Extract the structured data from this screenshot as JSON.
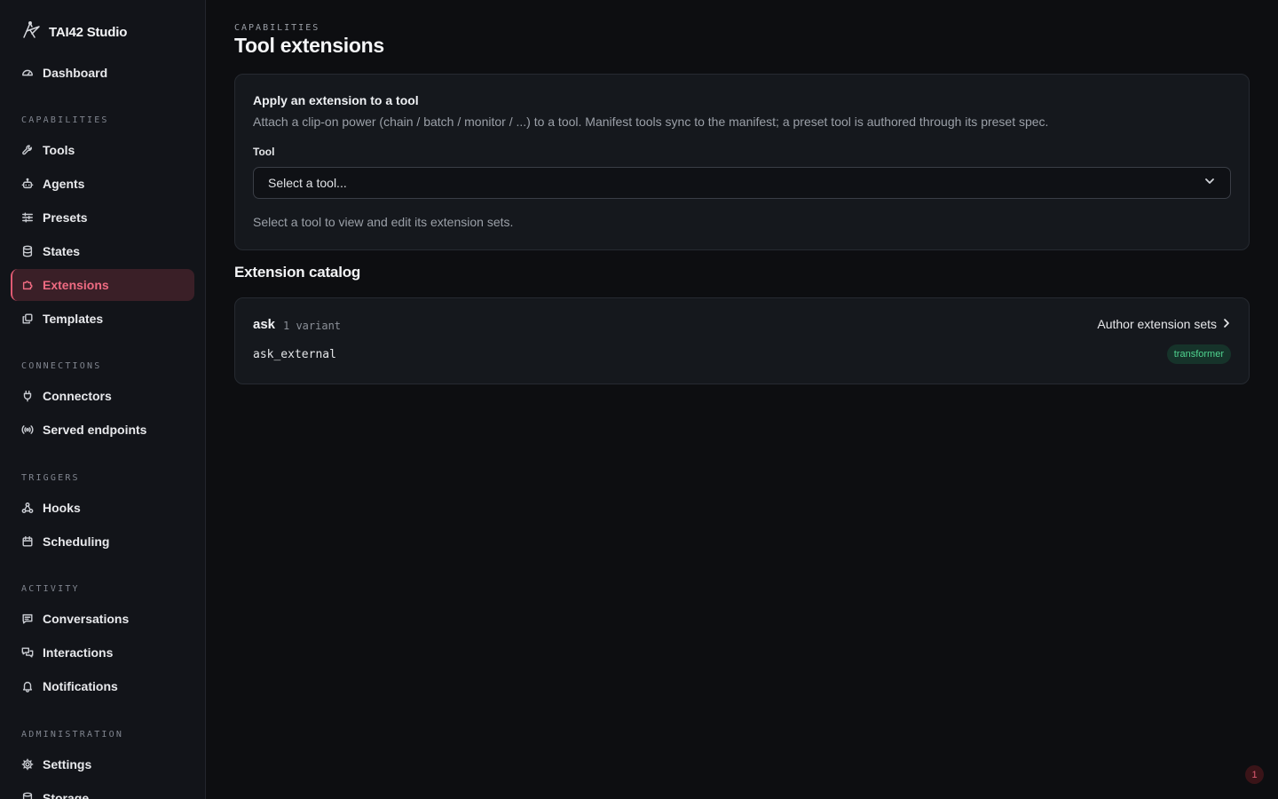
{
  "app": {
    "title": "TAI42 Studio"
  },
  "sidebar": {
    "dashboard": {
      "label": "Dashboard",
      "icon": "gauge-icon"
    },
    "sections": [
      {
        "label": "CAPABILITIES",
        "items": [
          {
            "label": "Tools",
            "icon": "wrench-icon"
          },
          {
            "label": "Agents",
            "icon": "bot-icon"
          },
          {
            "label": "Presets",
            "icon": "sliders-icon"
          },
          {
            "label": "States",
            "icon": "database-icon"
          },
          {
            "label": "Extensions",
            "icon": "puzzle-icon",
            "active": true
          },
          {
            "label": "Templates",
            "icon": "copy-icon"
          }
        ]
      },
      {
        "label": "CONNECTIONS",
        "items": [
          {
            "label": "Connectors",
            "icon": "plug-icon"
          },
          {
            "label": "Served endpoints",
            "icon": "broadcast-icon"
          }
        ]
      },
      {
        "label": "TRIGGERS",
        "items": [
          {
            "label": "Hooks",
            "icon": "webhook-icon"
          },
          {
            "label": "Scheduling",
            "icon": "calendar-icon"
          }
        ]
      },
      {
        "label": "ACTIVITY",
        "items": [
          {
            "label": "Conversations",
            "icon": "message-icon"
          },
          {
            "label": "Interactions",
            "icon": "messages-icon"
          },
          {
            "label": "Notifications",
            "icon": "bell-icon"
          }
        ]
      },
      {
        "label": "ADMINISTRATION",
        "items": [
          {
            "label": "Settings",
            "icon": "gear-icon"
          },
          {
            "label": "Storage",
            "icon": "database-icon"
          }
        ]
      }
    ]
  },
  "header": {
    "eyebrow": "CAPABILITIES",
    "title": "Tool extensions"
  },
  "apply": {
    "title": "Apply an extension to a tool",
    "description": "Attach a clip-on power (chain / batch / monitor / ...) to a tool. Manifest tools sync to the manifest; a preset tool is authored through its preset spec.",
    "field_label": "Tool",
    "select_value": "Select a tool...",
    "hint": "Select a tool to view and edit its extension sets."
  },
  "catalog": {
    "title": "Extension catalog",
    "entries": [
      {
        "name": "ask",
        "variant_count": "1 variant",
        "author_link": "Author extension sets",
        "variant_id": "ask_external",
        "badge": "transformer"
      }
    ]
  },
  "notifications": {
    "count": "1"
  },
  "colors": {
    "accent": "#e05a72",
    "badge_green": "#4fd38f",
    "background": "#0d0e11",
    "sidebar": "#121419",
    "card": "#15181d"
  }
}
